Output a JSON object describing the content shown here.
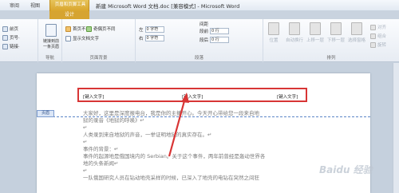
{
  "titlebar": {
    "tabs": [
      "审阅",
      "视图"
    ],
    "context_group": "页眉和页脚工具",
    "design_tab": "设计",
    "document_title": "新建 Microsoft Word 文档.doc [兼容模式] - Microsoft Word"
  },
  "ribbon": {
    "col1": {
      "line1": "前页",
      "line2": "页号·",
      "line3": "链接·"
    },
    "navigation": {
      "label": "导航",
      "link_prev": "链接到前一条页眉"
    },
    "options": {
      "label": "页面背景",
      "first_page": "首页不同",
      "odd_even": "奇偶页不同",
      "show_doc_text": "显示文档文字"
    },
    "paragraph": {
      "label": "段落",
      "indent_left_label": "左",
      "indent_left_value": "0 字符",
      "indent_right_label": "右",
      "indent_right_value": "0 字符",
      "spacing_label": "间距",
      "spacing_before_label": "段前",
      "spacing_before_value": "0 行",
      "spacing_after_label": "段后",
      "spacing_after_value": "0 行"
    },
    "arrange": {
      "label": "排列",
      "position": "位置",
      "wrap": "自动换行",
      "bring_forward": "上移一层",
      "send_backward": "下移一层",
      "selection_pane": "选择窗格",
      "align": "对齐",
      "group": "组合",
      "rotate": "旋转"
    }
  },
  "document": {
    "header_fields": [
      "[键入文字]",
      "[键入文字]",
      "[键入文字]"
    ],
    "header_tag": "页眉",
    "paragraphs": [
      "大家好，这里是深度报电台，我是你的主播开心。今天开心带给您一段来自地",
      "狱的录音《地狱的呼唤》↵",
      "↵",
      "人类录到来自地狱的声音，一举证明地狱的真实存在。↵",
      "↵",
      "事件的背景：↵",
      "事件的起源地是俄国境内的 Serbian。关于这个事件，两年前曾经是轰动世界各",
      "地的头条新闻↵",
      "↵",
      "一队俄国研究人员在钻动地壳采样的时候，已深入了地壳的电钻在突然之间狂"
    ],
    "watermark": "Baidu 经验"
  }
}
